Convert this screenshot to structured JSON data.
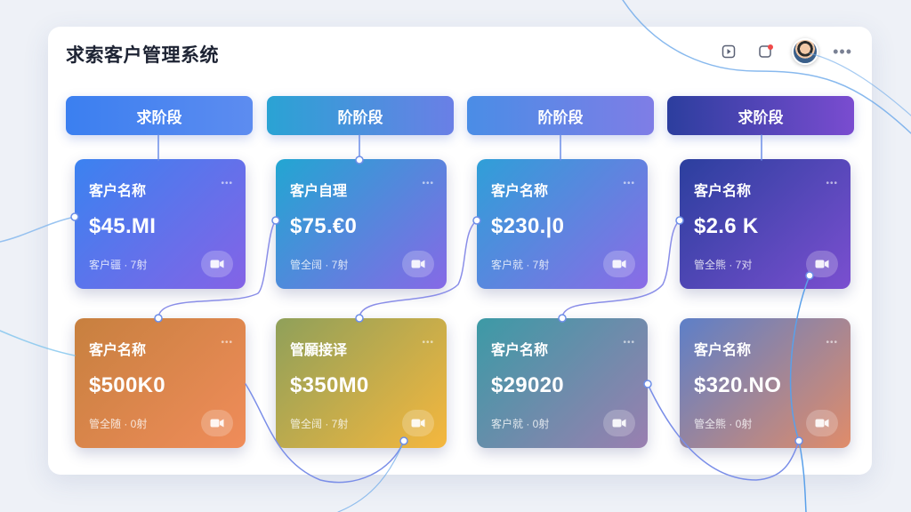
{
  "app": {
    "title": "求索客户管理系统"
  },
  "toolbar": {
    "icons": [
      "square-play-icon",
      "notification-icon",
      "avatar",
      "more-icon"
    ],
    "more_label": "•••"
  },
  "stages": [
    {
      "label": "求阶段",
      "color_from": "#3b7ff0",
      "color_to": "#5d8cf0"
    },
    {
      "label": "阶阶段",
      "color_from": "#2aa3d4",
      "color_to": "#6a7fe6"
    },
    {
      "label": "阶阶段",
      "color_from": "#4a8de6",
      "color_to": "#7f7de6"
    },
    {
      "label": "求阶段",
      "color_from": "#2c3e9e",
      "color_to": "#7a4cd0"
    }
  ],
  "cards_row1": [
    {
      "name": "客户名称",
      "amount": "$45.MI",
      "meta": "客户疆 · 7射",
      "color_from": "#3b82f0",
      "color_to": "#8463e6"
    },
    {
      "name": "客户自理",
      "amount": "$75.€0",
      "meta": "管全阔 · 7射",
      "color_from": "#22a6d2",
      "color_to": "#8669e6"
    },
    {
      "name": "客户名称",
      "amount": "$230.|0",
      "meta": "客户就 · 7射",
      "color_from": "#2f9fd8",
      "color_to": "#8b6be6"
    },
    {
      "name": "客户名称",
      "amount": "$2.6 K",
      "meta": "管全熊 · 7对",
      "color_from": "#2b3f9e",
      "color_to": "#7b4fd0"
    }
  ],
  "cards_row2": [
    {
      "name": "客户名称",
      "amount": "$500K0",
      "meta": "管全随 · 0射",
      "color_from": "#c7803f",
      "color_to": "#f08c5a"
    },
    {
      "name": "管願接译",
      "amount": "$350M0",
      "meta": "管全阔 · 7射",
      "color_from": "#8fa05a",
      "color_to": "#f5b73e"
    },
    {
      "name": "客户名称",
      "amount": "$29020",
      "meta": "客户就 · 0射",
      "color_from": "#3c9aa6",
      "color_to": "#9a7fb0"
    },
    {
      "name": "客户名称",
      "amount": "$320.NO",
      "meta": "管全熊 · 0射",
      "color_from": "#5d7fc8",
      "color_to": "#e08c6a"
    }
  ]
}
